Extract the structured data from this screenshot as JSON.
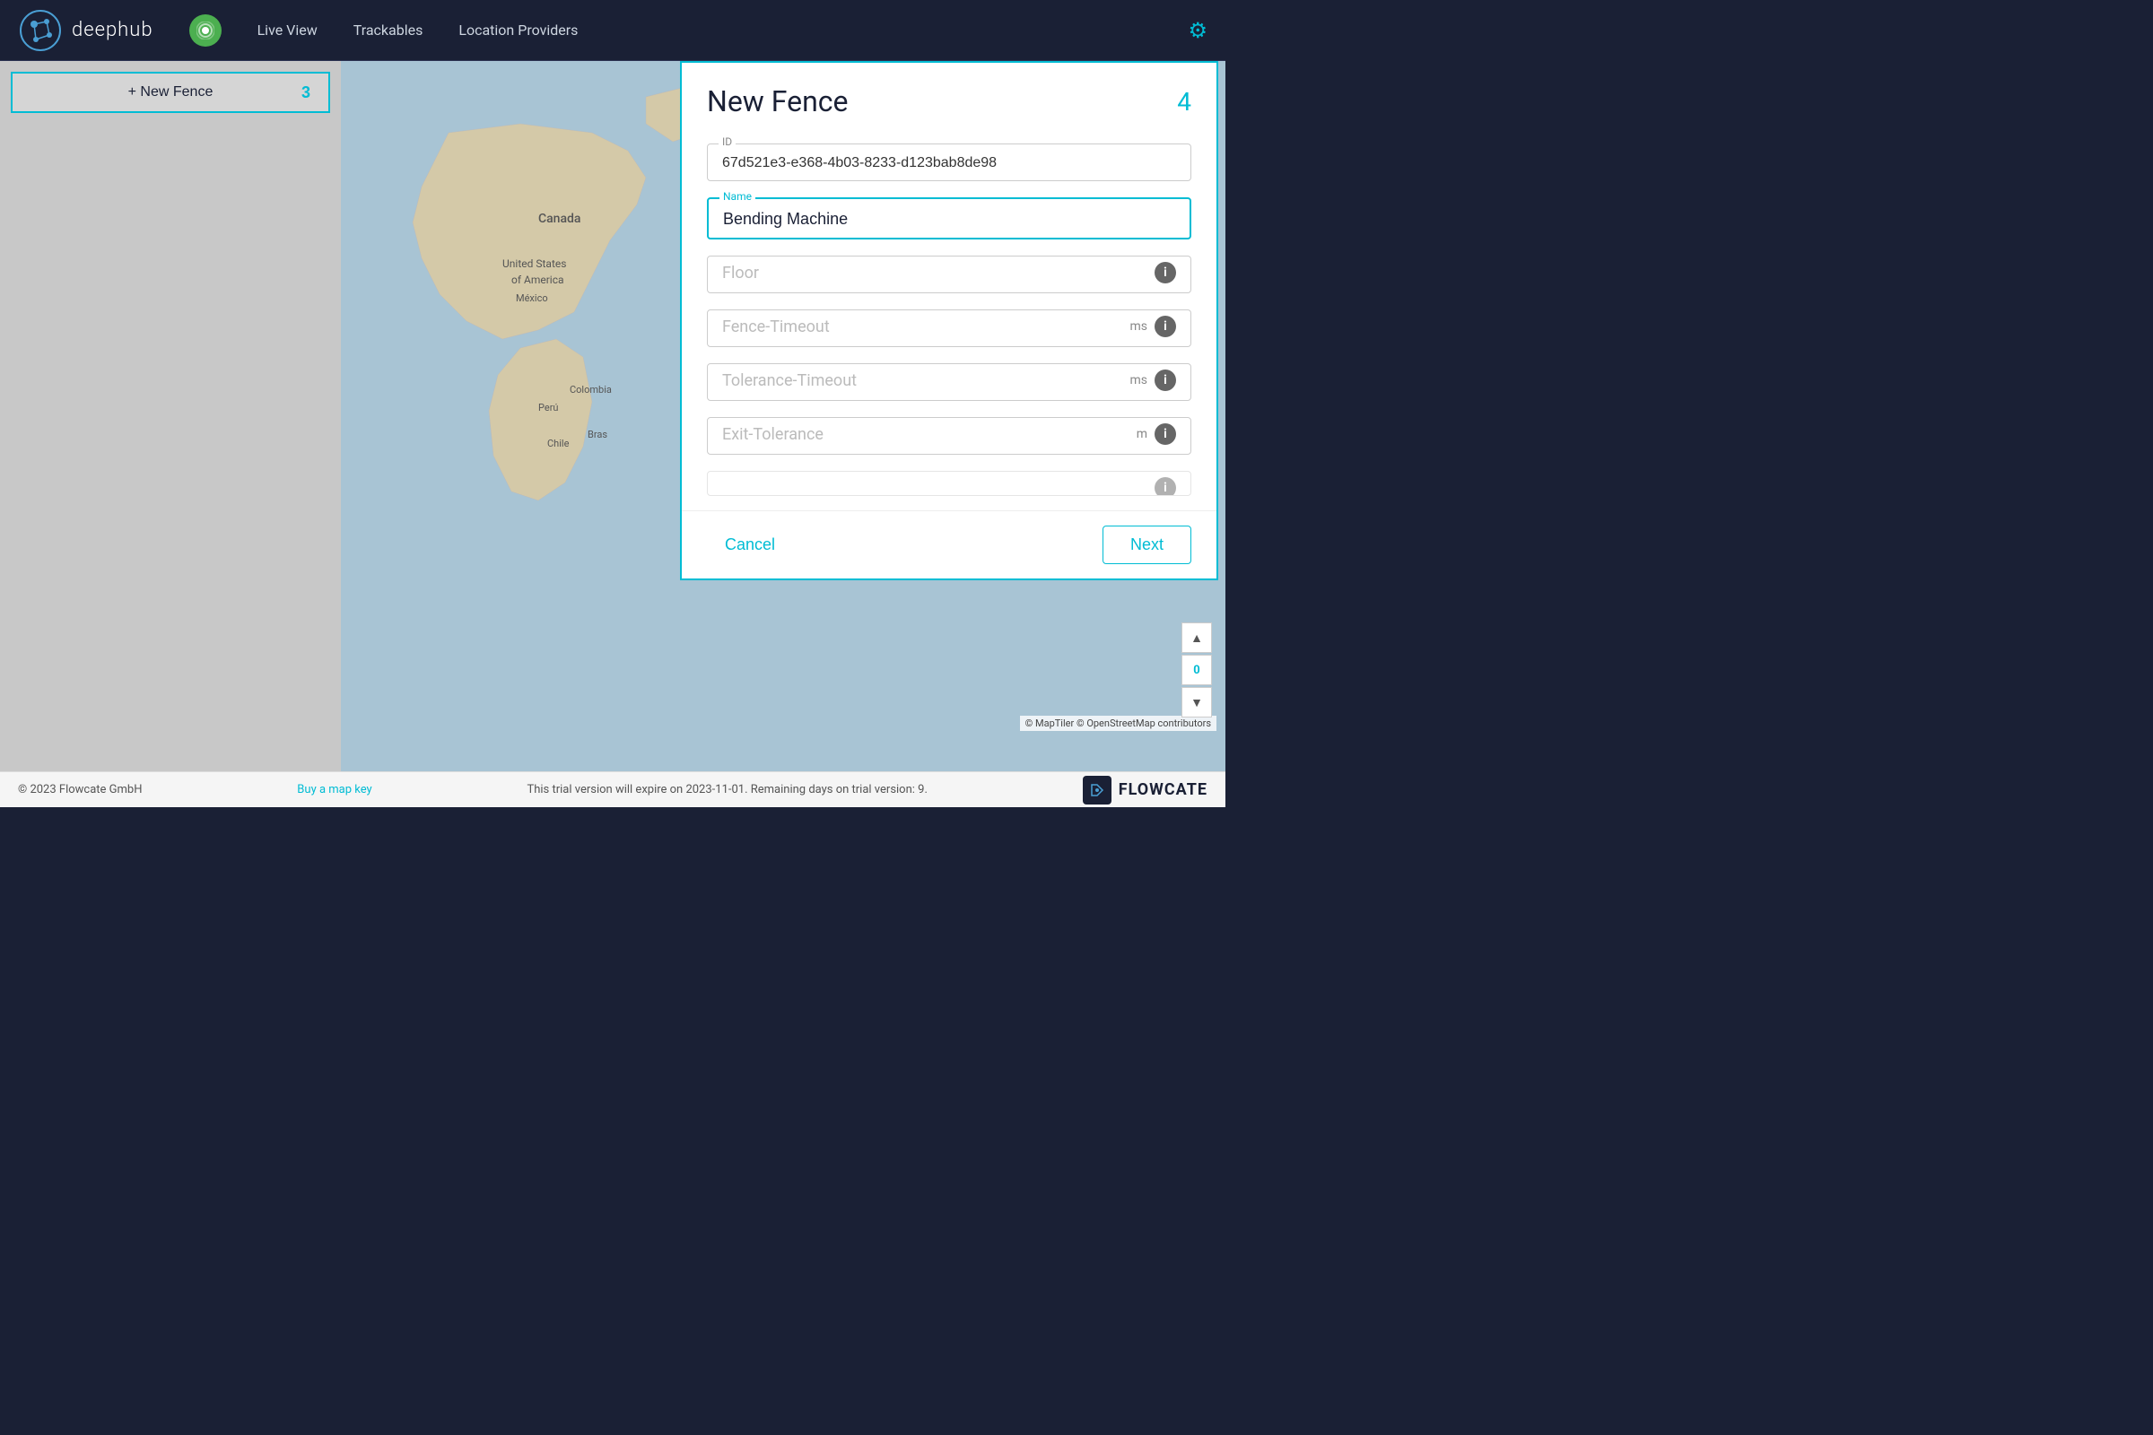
{
  "navbar": {
    "logo_text": "deephub",
    "nav_items": [
      {
        "label": "Live View",
        "id": "live-view"
      },
      {
        "label": "Trackables",
        "id": "trackables"
      },
      {
        "label": "Location Providers",
        "id": "location-providers"
      }
    ],
    "settings_label": "⚙"
  },
  "sidebar": {
    "new_fence_label": "+ New Fence",
    "step_badge": "3"
  },
  "dialog": {
    "title": "New Fence",
    "step": "4",
    "fields": {
      "id": {
        "label": "ID",
        "value": "67d521e3-e368-4b03-8233-d123bab8de98",
        "placeholder": ""
      },
      "name": {
        "label": "Name",
        "value": "Bending Machine",
        "placeholder": ""
      },
      "floor": {
        "label": "",
        "value": "",
        "placeholder": "Floor"
      },
      "fence_timeout": {
        "label": "",
        "value": "",
        "placeholder": "Fence-Timeout",
        "unit": "ms"
      },
      "tolerance_timeout": {
        "label": "",
        "value": "",
        "placeholder": "Tolerance-Timeout",
        "unit": "ms"
      },
      "exit_tolerance": {
        "label": "",
        "value": "",
        "placeholder": "Exit-Tolerance",
        "unit": "m"
      }
    },
    "cancel_label": "Cancel",
    "next_label": "Next"
  },
  "map": {
    "zoom_value": "0",
    "controls": {
      "zoom_in": "+",
      "zoom_out": "−",
      "north": "▲",
      "target": "◎",
      "layers": "◆",
      "locate": "⊕",
      "chevron_up": "▲",
      "chevron_down": "▼"
    }
  },
  "footer": {
    "copyright": "© 2023 Flowcate GmbH",
    "map_key_link": "Buy a map key",
    "trial_text": "This trial version will expire on 2023-11-01. Remaining days on trial version: 9.",
    "brand_label": "FLOWCATE",
    "maptiler_credit": "© MapTiler © OpenStreetMap contributors"
  }
}
